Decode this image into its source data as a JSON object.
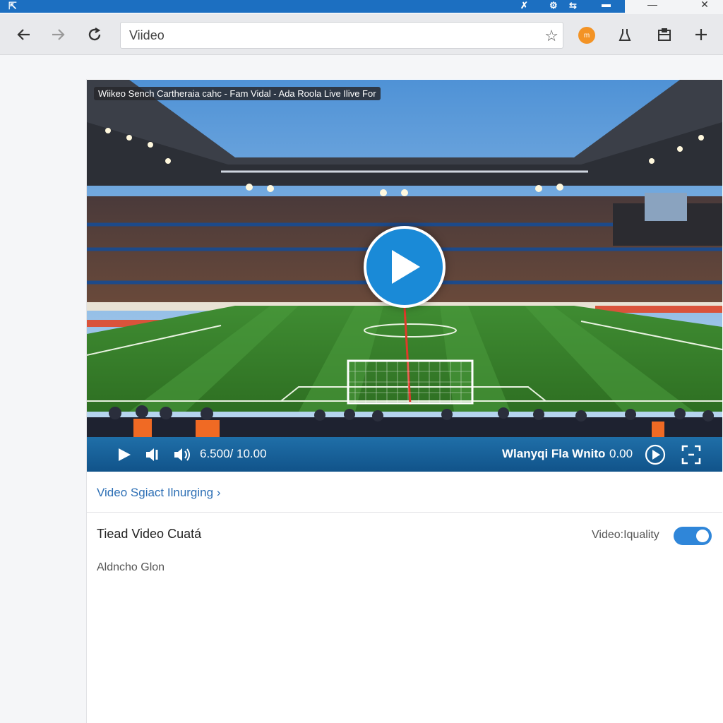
{
  "window": {
    "controls": {
      "minimize": "—",
      "maximize": "☐",
      "close": "✕"
    }
  },
  "toolbar": {
    "address": {
      "value": "Viideo",
      "placeholder": ""
    },
    "extension_badge": "m"
  },
  "video": {
    "title": "Wiikeo Sench Cartheraia cahc - Fam Vidal - Ada Roola Live Ilive For",
    "time": "6.500/ 10.00",
    "quality_label": "Wlanyqi Fla Wnito",
    "quality_time": "0.00"
  },
  "page": {
    "related_link": "Video Sgiact Ilnurging",
    "related_chevron": "›",
    "section_title": "Tiead Video Cuatá",
    "section_subtitle": "Aldncho Glon",
    "toggle": {
      "label": "Video:Iquality",
      "on": true
    }
  },
  "colors": {
    "title_bar": "#1c6fc1",
    "accent": "#1a8ad7",
    "controls_bar": "#11538a",
    "link": "#2d6fb5",
    "toggle_on": "#2f86d9"
  }
}
